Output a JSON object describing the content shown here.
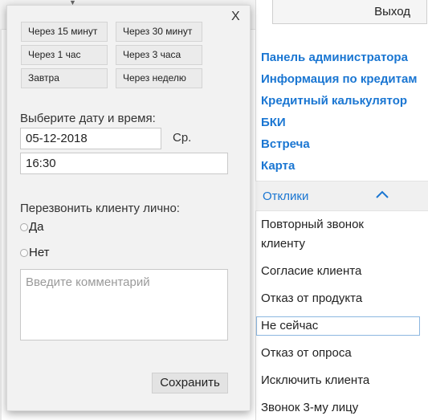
{
  "header": {
    "logout_label": "Выход"
  },
  "nav": {
    "links": [
      "Панель администратора",
      "Информация по кредитам",
      "Кредитный калькулятор",
      "БКИ",
      "Встреча",
      "Карта"
    ]
  },
  "responses": {
    "title": "Отклики",
    "items": [
      "Повторный звонок",
      "клиенту",
      "Согласие клиента",
      "Отказ от продукта",
      "Не сейчас",
      "Отказ от опроса",
      "Исключить клиента",
      "Звонок 3-му лицу"
    ],
    "selected_index": 4
  },
  "popup": {
    "close_label": "X",
    "quick_buttons": [
      "Через 15 минут",
      "Через 30 минут",
      "Через 1 час",
      "Через 3 часа",
      "Завтра",
      "Через неделю"
    ],
    "datetime_label": "Выберите дату и время:",
    "date_value": "05-12-2018",
    "weekday": "Ср.",
    "time_value": "16:30",
    "callback_label": "Перезвонить клиенту лично:",
    "radio_yes": "Да",
    "radio_no": "Нет",
    "comment_placeholder": "Введите комментарий",
    "save_label": "Сохранить"
  },
  "colors": {
    "link": "#1a76d2",
    "popup_bg": "#f2f2f2",
    "selected_border": "#8cb7e0"
  }
}
